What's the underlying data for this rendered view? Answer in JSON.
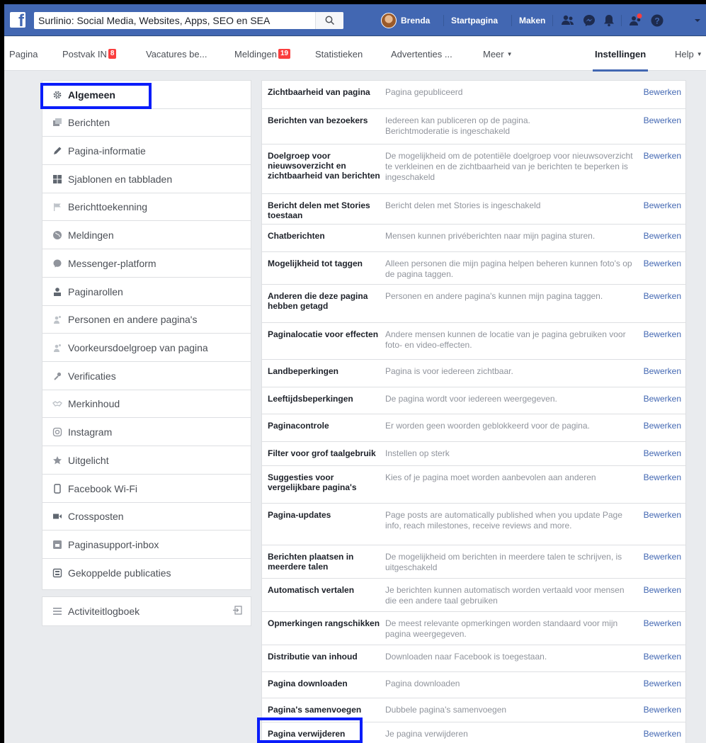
{
  "topbar": {
    "search_value": "Surlinio: Social Media, Websites, Apps, SEO en SEA",
    "user_name": "Brenda",
    "home_label": "Startpagina",
    "create_label": "Maken"
  },
  "pagenav": {
    "tabs": [
      {
        "label": "Pagina",
        "badge": ""
      },
      {
        "label": "Postvak IN",
        "badge": "8"
      },
      {
        "label": "Vacatures be...",
        "badge": ""
      },
      {
        "label": "Meldingen",
        "badge": "19"
      },
      {
        "label": "Statistieken",
        "badge": ""
      },
      {
        "label": "Advertenties ...",
        "badge": ""
      },
      {
        "label": "Meer",
        "badge": ""
      },
      {
        "label": "Instellingen",
        "badge": ""
      },
      {
        "label": "Help",
        "badge": ""
      }
    ]
  },
  "sidebar": {
    "items": [
      {
        "label": "Algemeen",
        "icon": "gear-icon"
      },
      {
        "label": "Berichten",
        "icon": "messages-icon"
      },
      {
        "label": "Pagina-informatie",
        "icon": "pencil-icon"
      },
      {
        "label": "Sjablonen en tabbladen",
        "icon": "grid-icon"
      },
      {
        "label": "Berichttoekenning",
        "icon": "flag-icon"
      },
      {
        "label": "Meldingen",
        "icon": "globe-icon"
      },
      {
        "label": "Messenger-platform",
        "icon": "messenger-icon"
      },
      {
        "label": "Paginarollen",
        "icon": "person-icon"
      },
      {
        "label": "Personen en andere pagina's",
        "icon": "people-icon"
      },
      {
        "label": "Voorkeursdoelgroep van pagina",
        "icon": "audience-icon"
      },
      {
        "label": "Verificaties",
        "icon": "wrench-icon"
      },
      {
        "label": "Merkinhoud",
        "icon": "handshake-icon"
      },
      {
        "label": "Instagram",
        "icon": "instagram-icon"
      },
      {
        "label": "Uitgelicht",
        "icon": "star-icon"
      },
      {
        "label": "Facebook Wi-Fi",
        "icon": "phone-icon"
      },
      {
        "label": "Crossposten",
        "icon": "video-icon"
      },
      {
        "label": "Paginasupport-inbox",
        "icon": "support-icon"
      },
      {
        "label": "Gekoppelde publicaties",
        "icon": "publication-icon"
      }
    ],
    "activity_label": "Activiteitlogboek"
  },
  "settings": {
    "edit_label": "Bewerken",
    "rows": [
      {
        "label": "Zichtbaarheid van pagina",
        "desc": "Pagina gepubliceerd"
      },
      {
        "label": "Berichten van bezoekers",
        "desc": "Iedereen kan publiceren op de pagina.\nBerichtmoderatie is ingeschakeld"
      },
      {
        "label": "Doelgroep voor nieuwsoverzicht en zichtbaarheid van berichten",
        "desc": "De mogelijkheid om de potentiële doelgroep voor nieuwsoverzicht te verkleinen en de zichtbaarheid van je berichten te beperken is ingeschakeld"
      },
      {
        "label": "Bericht delen met Stories toestaan",
        "desc": "Bericht delen met Stories is ingeschakeld"
      },
      {
        "label": "Chatberichten",
        "desc": "Mensen kunnen privéberichten naar mijn pagina sturen."
      },
      {
        "label": "Mogelijkheid tot taggen",
        "desc": "Alleen personen die mijn pagina helpen beheren kunnen foto's op de pagina taggen."
      },
      {
        "label": "Anderen die deze pagina hebben getagd",
        "desc": "Personen en andere pagina's kunnen mijn pagina taggen."
      },
      {
        "label": "Paginalocatie voor effecten",
        "desc": "Andere mensen kunnen de locatie van je pagina gebruiken voor foto- en video-effecten."
      },
      {
        "label": "Landbeperkingen",
        "desc": "Pagina is voor iedereen zichtbaar."
      },
      {
        "label": "Leeftijdsbeperkingen",
        "desc": "De pagina wordt voor iedereen weergegeven."
      },
      {
        "label": "Paginacontrole",
        "desc": "Er worden geen woorden geblokkeerd voor de pagina."
      },
      {
        "label": "Filter voor grof taalgebruik",
        "desc": "Instellen op sterk"
      },
      {
        "label": "Suggesties voor vergelijkbare pagina's",
        "desc": "Kies of je pagina moet worden aanbevolen aan anderen"
      },
      {
        "label": "Pagina-updates",
        "desc": "Page posts are automatically published when you update Page info, reach milestones, receive reviews and more."
      },
      {
        "label": "Berichten plaatsen in meerdere talen",
        "desc": "De mogelijkheid om berichten in meerdere talen te schrijven, is uitgeschakeld"
      },
      {
        "label": "Automatisch vertalen",
        "desc": "Je berichten kunnen automatisch worden vertaald voor mensen die een andere taal gebruiken"
      },
      {
        "label": "Opmerkingen rangschikken",
        "desc": "De meest relevante opmerkingen worden standaard voor mijn pagina weergegeven."
      },
      {
        "label": "Distributie van inhoud",
        "desc": "Downloaden naar Facebook is toegestaan."
      },
      {
        "label": "Pagina downloaden",
        "desc": "Pagina downloaden"
      },
      {
        "label": "Pagina's samenvoegen",
        "desc": "Dubbele pagina's samenvoegen"
      },
      {
        "label": "Pagina verwijderen",
        "desc": "Je pagina verwijderen"
      }
    ]
  },
  "colors": {
    "facebook_blue": "#4267b2",
    "highlight_blue": "#0a1dfa",
    "badge_red": "#fa3e3e"
  }
}
